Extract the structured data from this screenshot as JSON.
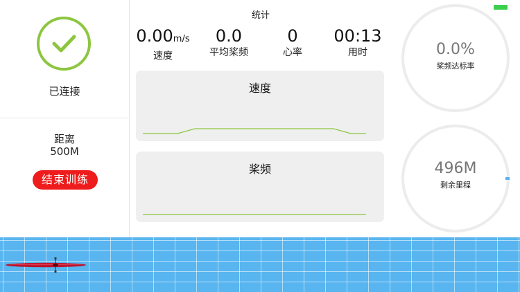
{
  "status": {
    "connected_label": "已连接"
  },
  "distance": {
    "label": "距离",
    "value": "500M"
  },
  "actions": {
    "end_training_label": "结束训练"
  },
  "stats": {
    "title": "统计",
    "speed": {
      "value": "0.00",
      "unit": "m/s",
      "label": "速度"
    },
    "avg_cadence": {
      "value": "0.0",
      "label": "平均桨频"
    },
    "heart_rate": {
      "value": "0",
      "label": "心率"
    },
    "elapsed": {
      "value": "00:13",
      "label": "用时"
    }
  },
  "charts": {
    "speed": {
      "title": "速度",
      "line_color": "#8cc63f"
    },
    "cadence": {
      "title": "桨频",
      "line_color": "#8cc63f"
    }
  },
  "rings": {
    "cadence_rate": {
      "value": "0.0%",
      "label": "桨频达标率"
    },
    "remaining": {
      "value": "496M",
      "label": "剩余里程"
    }
  },
  "colors": {
    "accent_green": "#8cc63f",
    "danger_red": "#ee1c1c",
    "water_blue": "#58b5ef",
    "battery_green": "#3ccf4e"
  },
  "icons": {
    "status_icon": "checkmark-icon",
    "boat_icon": "kayak-icon"
  }
}
